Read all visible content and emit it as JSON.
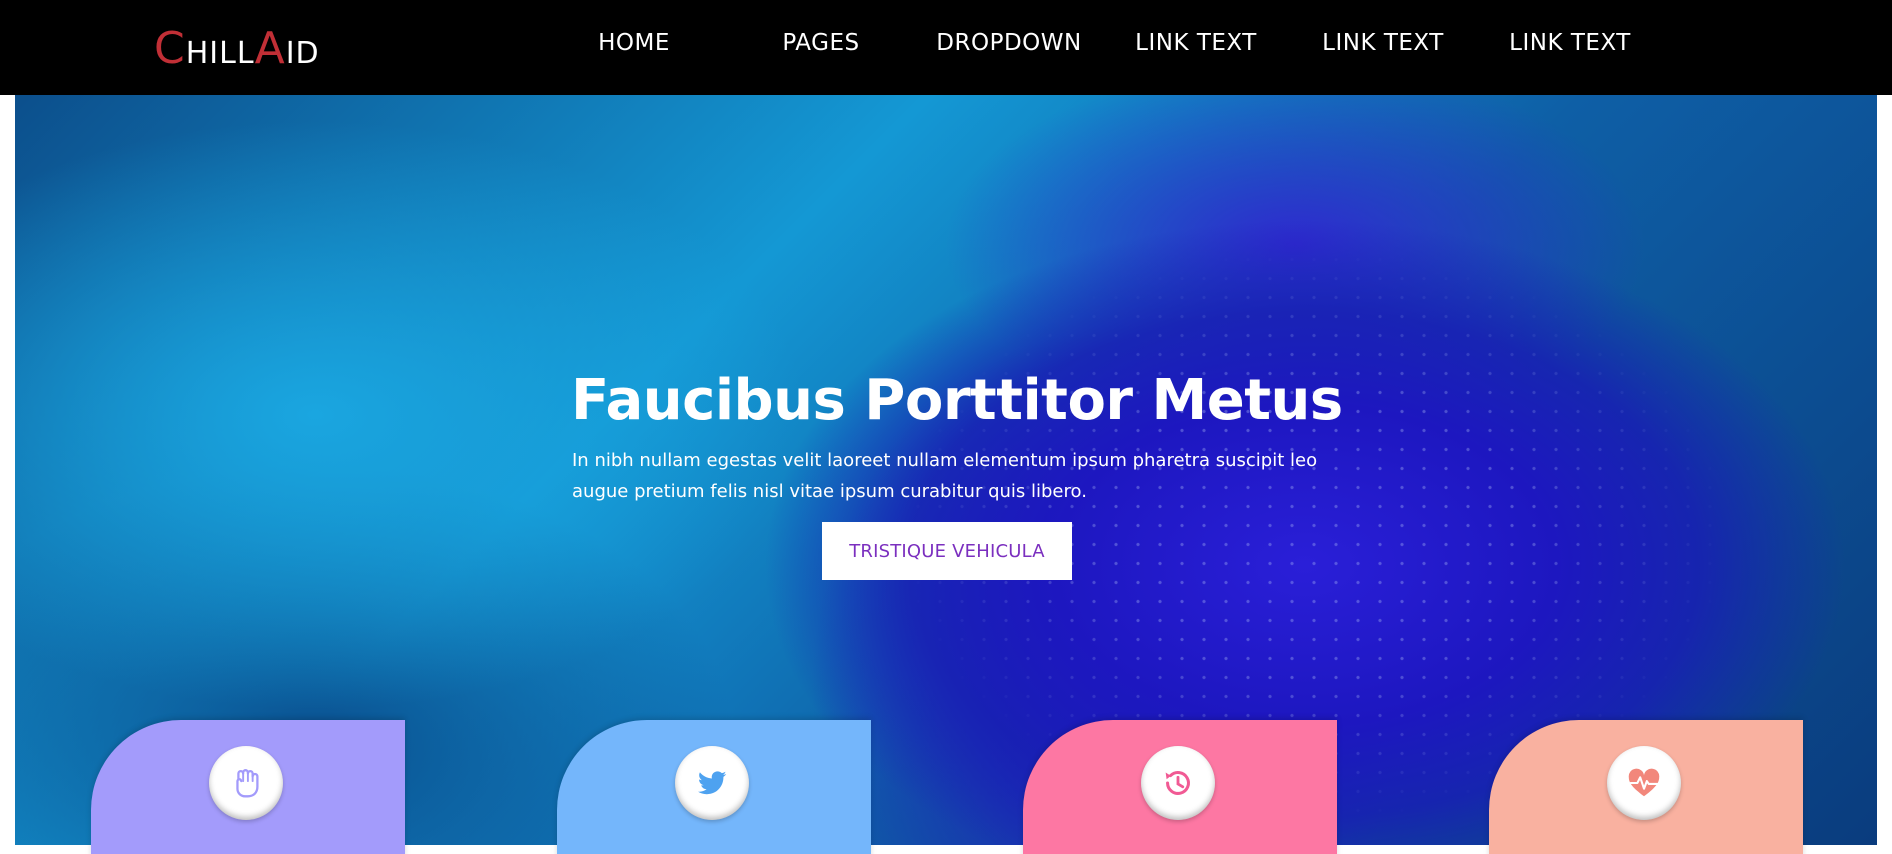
{
  "brand": {
    "logo_c": "C",
    "logo_hill": "HILL",
    "logo_a": "A",
    "logo_id": "ID",
    "accent_color": "#c12f36"
  },
  "nav": {
    "items": [
      {
        "label": "HOME"
      },
      {
        "label": "PAGES"
      },
      {
        "label": "DROPDOWN"
      },
      {
        "label": "LINK TEXT"
      },
      {
        "label": "LINK TEXT"
      },
      {
        "label": "LINK TEXT"
      }
    ]
  },
  "hero": {
    "title": "Faucibus Porttitor Metus",
    "text_line1": "In nibh nullam egestas velit laoreet nullam elementum ipsum pharetra suscipit leo",
    "text_line2": "augue pretium felis nisl vitae ipsum curabitur quis libero.",
    "button_label": "TRISTIQUE VEHICULA",
    "button_color": "#7b2fbf"
  },
  "cards": [
    {
      "icon": "hand-icon",
      "color": "#a39bfb",
      "icon_color": "#a39bfb"
    },
    {
      "icon": "twitter-icon",
      "color": "#74b6fb",
      "icon_color": "#4ea2f0"
    },
    {
      "icon": "history-icon",
      "color": "#fd77a3",
      "icon_color": "#f15a94"
    },
    {
      "icon": "heartbeat-icon",
      "color": "#f9b1a0",
      "icon_color": "#f2877b"
    }
  ]
}
